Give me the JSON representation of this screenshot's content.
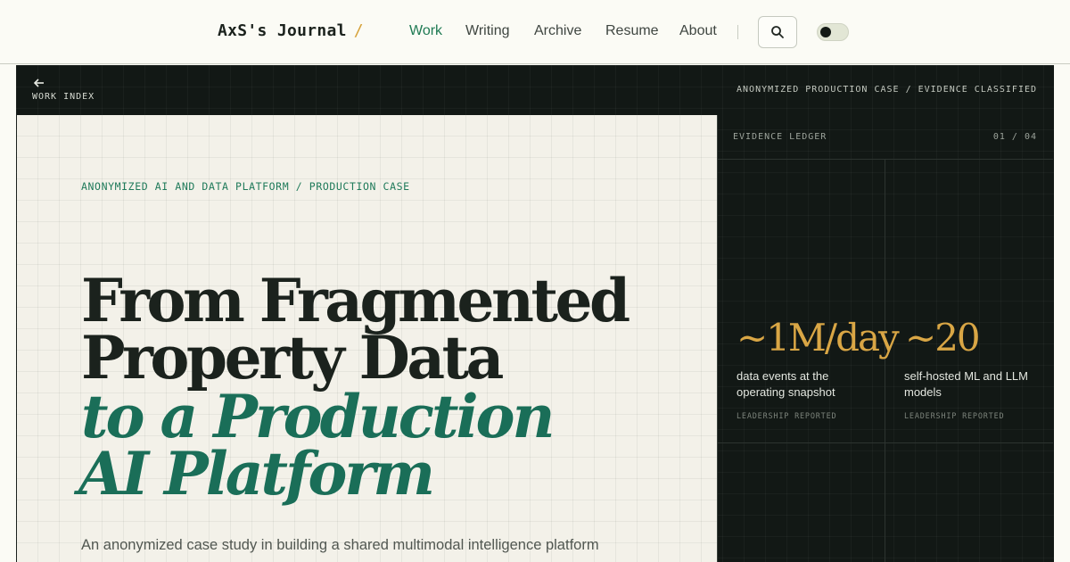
{
  "site": {
    "brand": "AxS's Journal",
    "brand_slash": "/"
  },
  "nav": {
    "items": [
      {
        "label": "Work",
        "active": true
      },
      {
        "label": "Writing",
        "active": false
      },
      {
        "label": "Archive",
        "active": false
      },
      {
        "label": "Resume",
        "active": false
      },
      {
        "label": "About",
        "active": false
      }
    ],
    "search_icon": "search-icon",
    "theme_toggle": "theme-toggle"
  },
  "frame": {
    "back_icon": "arrow-left-icon",
    "back_label": "WORK INDEX",
    "case_label": "ANONYMIZED PRODUCTION CASE / EVIDENCE CLASSIFIED"
  },
  "hero": {
    "eyebrow": "ANONYMIZED AI AND DATA PLATFORM / PRODUCTION CASE",
    "title_lines": [
      "From Fragmented",
      "Property Data"
    ],
    "title_italic_lines": [
      "to a Production",
      "AI Platform"
    ],
    "lede": "An anonymized case study in building a shared multimodal intelligence platform"
  },
  "ledger": {
    "title": "EVIDENCE LEDGER",
    "count": "01 / 04",
    "metrics": [
      {
        "value": "~1M/day",
        "desc": "data events at the operating snapshot",
        "source": "LEADERSHIP REPORTED"
      },
      {
        "value": "~20",
        "desc": "self-hosted ML and LLM models",
        "source": "LEADERSHIP REPORTED"
      }
    ]
  },
  "colors": {
    "accent_green": "#1f7a53",
    "accent_gold": "#d9a645",
    "dark_bg": "#121815",
    "light_bg": "#f3f1e9"
  }
}
